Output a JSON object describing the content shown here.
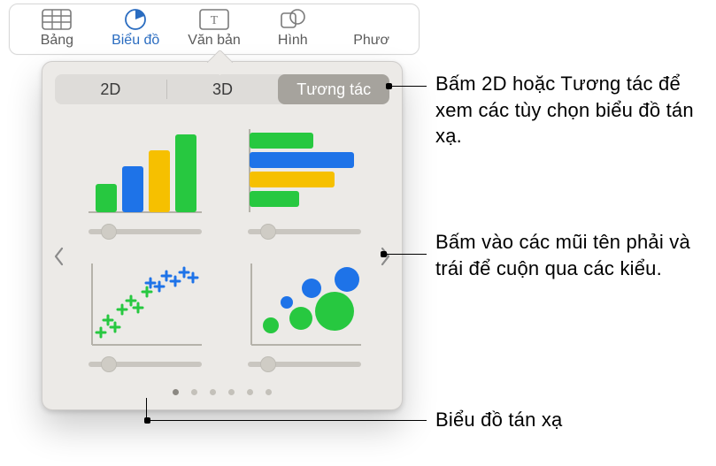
{
  "toolbar": {
    "items": [
      {
        "label": "Bảng",
        "icon": "table-icon"
      },
      {
        "label": "Biểu đồ",
        "icon": "chart-icon"
      },
      {
        "label": "Văn bản",
        "icon": "text-icon"
      },
      {
        "label": "Hình",
        "icon": "shape-icon"
      },
      {
        "label": "Phươ",
        "icon": "media-icon"
      }
    ],
    "active_index": 1
  },
  "popover": {
    "tabs": {
      "a": "2D",
      "b": "3D",
      "c": "Tương tác",
      "selected": "c"
    },
    "options": [
      {
        "name": "interactive-column-chart"
      },
      {
        "name": "interactive-bar-chart"
      },
      {
        "name": "scatter-chart"
      },
      {
        "name": "bubble-chart"
      }
    ],
    "page_count": 6,
    "page_index": 0
  },
  "annotations": {
    "a1": "Bấm 2D hoặc Tương tác để xem các tùy chọn biểu đồ tán xạ.",
    "a2": "Bấm vào các mũi tên phải và trái để cuộn qua các kiểu.",
    "a3": "Biểu đồ tán xạ"
  },
  "colors": {
    "green": "#27C840",
    "blue": "#1E73E8",
    "yellow": "#F6C000"
  }
}
